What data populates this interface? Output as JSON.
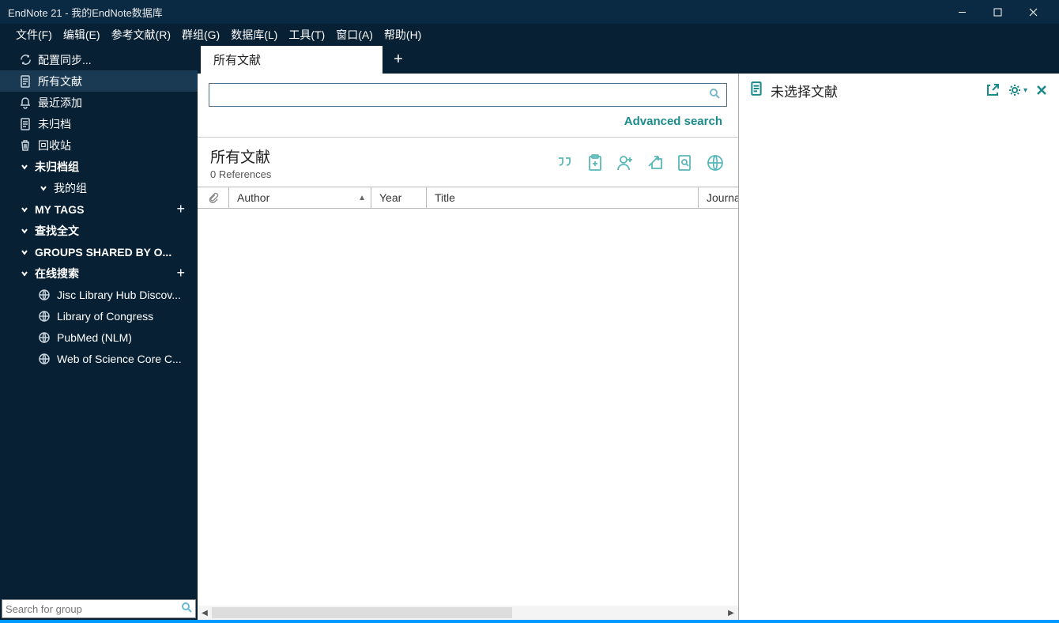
{
  "titlebar": {
    "text": "EndNote 21 - 我的EndNote数据库"
  },
  "menu": {
    "file": "文件(F)",
    "edit": "编辑(E)",
    "references": "参考文献(R)",
    "groups": "群组(G)",
    "library": "数据库(L)",
    "tools": "工具(T)",
    "window": "窗口(A)",
    "help": "帮助(H)"
  },
  "sidebar": {
    "sync": "配置同步...",
    "all": "所有文献",
    "recent": "最近添加",
    "unfiled": "未归档",
    "trash": "回收站",
    "group_unfiled": "未归档组",
    "my_group": "我的组",
    "my_tags": "MY TAGS",
    "find_fulltext": "查找全文",
    "groups_shared": "GROUPS SHARED BY O...",
    "online_search": "在线搜索",
    "online": {
      "jisc": "Jisc Library Hub Discov...",
      "loc": "Library of Congress",
      "pubmed": "PubMed (NLM)",
      "wos": "Web of Science Core C..."
    },
    "search_placeholder": "Search for group"
  },
  "tabs": {
    "active": "所有文献"
  },
  "search": {
    "advanced": "Advanced search"
  },
  "list": {
    "title": "所有文献",
    "count": "0 References",
    "columns": {
      "author": "Author",
      "year": "Year",
      "title": "Title",
      "journal": "Journal"
    }
  },
  "right": {
    "title": "未选择文献"
  }
}
